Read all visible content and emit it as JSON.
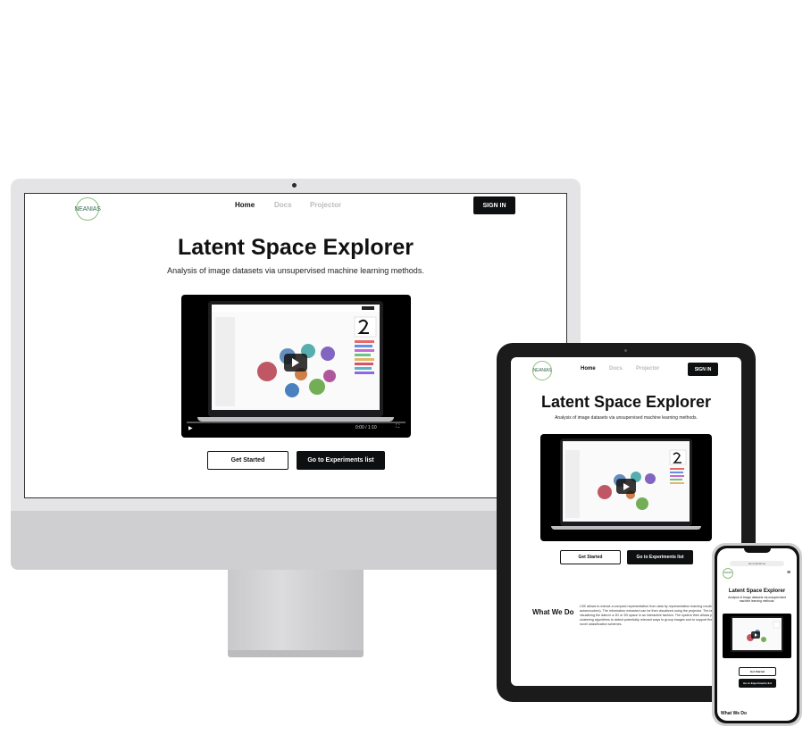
{
  "app": {
    "logo_text": "NEANIAS",
    "nav": [
      "Home",
      "Docs",
      "Projector"
    ],
    "signin_label": "SIGN IN",
    "title": "Latent Space Explorer",
    "subtitle": "Analysis of image datasets via unsupervised machine learning methods.",
    "btn_get_started": "Get Started",
    "btn_experiments": "Go to Experiments list",
    "video_time": "0:00 / 1:10",
    "what_we_do_title": "What We Do",
    "what_we_do_text": "LSE allows to extract a compact representation from data by representation learning models (e.g. autoencoders). The information extracted can be then visualized using the projector. The latter allows visualizing the data in a 2D or 3D space in an interactive fashion. The system then allows performing clustering algorithms to detect potentially relevant ways to group images and to support the definition of novel classification schemes."
  },
  "phone": {
    "url": "lse.neanias.eu"
  },
  "colors": {
    "dark": "#0d0f10",
    "nav_inactive": "#bbbbbb",
    "logo_green": "#8dc07a"
  }
}
